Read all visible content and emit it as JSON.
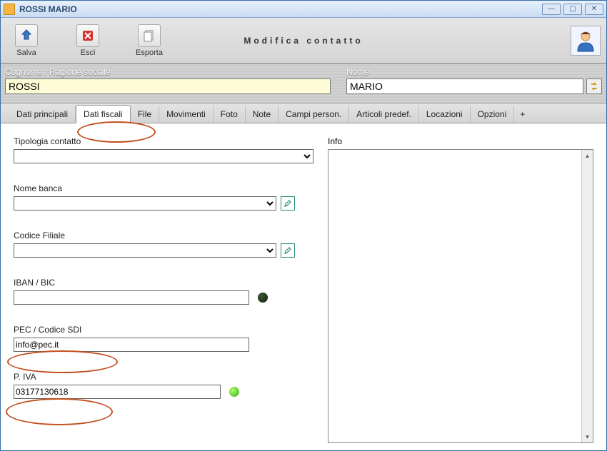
{
  "window": {
    "title": "ROSSI MARIO",
    "minimize": "―",
    "maximize": "▢",
    "close": "✕"
  },
  "toolbar": {
    "salva": "Salva",
    "esci": "Esci",
    "esporta": "Esporta",
    "page_title": "Modifica contatto"
  },
  "header": {
    "cognome_label": "Cognome / Ragione sociale",
    "cognome_value": "ROSSI",
    "nome_label": "Nome",
    "nome_value": "MARIO"
  },
  "tabs": {
    "dati_principali": "Dati principali",
    "dati_fiscali": "Dati fiscali",
    "file": "File",
    "movimenti": "Movimenti",
    "foto": "Foto",
    "note": "Note",
    "campi": "Campi person.",
    "articoli": "Articoli predef.",
    "locazioni": "Locazioni",
    "opzioni": "Opzioni",
    "plus": "+"
  },
  "form": {
    "tipologia_label": "Tipologia contatto",
    "tipologia_value": "",
    "nome_banca_label": "Nome banca",
    "nome_banca_value": "",
    "codice_filiale_label": "Codice Filiale",
    "codice_filiale_value": "",
    "iban_label": "IBAN / BIC",
    "iban_value": "",
    "pec_label": "PEC / Codice SDI",
    "pec_value": "info@pec.it",
    "piva_label": "P. IVA",
    "piva_value": "03177130618",
    "info_label": "Info"
  }
}
